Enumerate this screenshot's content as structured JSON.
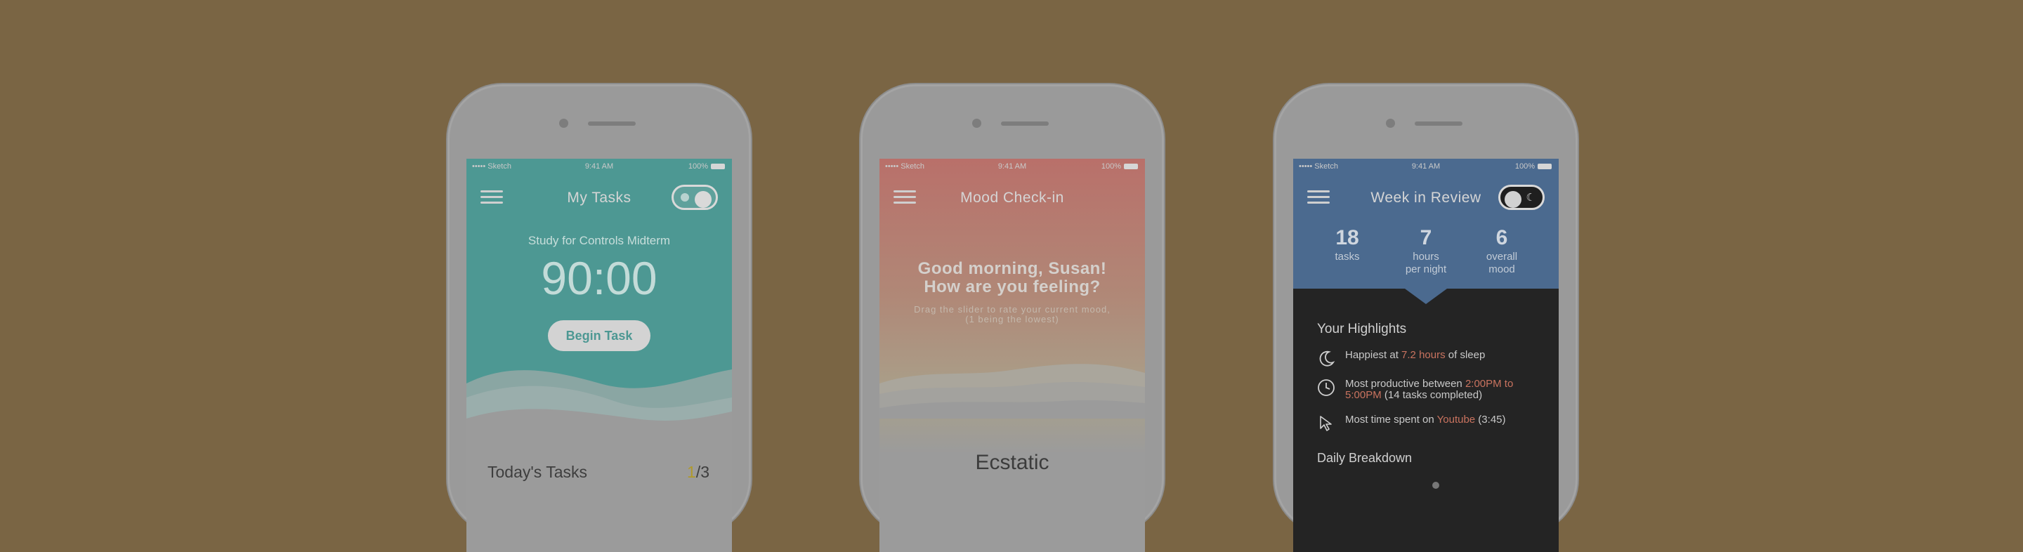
{
  "status": {
    "carrier": "••••• Sketch",
    "time": "9:41 AM",
    "battery": "100%"
  },
  "screen1": {
    "title": "My Tasks",
    "current_task": "Study for Controls Midterm",
    "timer": "90:00",
    "begin_label": "Begin Task",
    "section_label": "Today's Tasks",
    "count_done": "1",
    "count_total": "/3"
  },
  "screen2": {
    "title": "Mood Check-in",
    "greeting_line1": "Good morning, Susan!",
    "greeting_line2": "How are you feeling?",
    "hint_line1": "Drag the slider to rate your current mood,",
    "hint_line2": "(1 being the lowest)",
    "mood_label": "Ecstatic"
  },
  "screen3": {
    "title": "Week in Review",
    "stats": [
      {
        "value": "18",
        "label1": "tasks",
        "label2": ""
      },
      {
        "value": "7",
        "label1": "hours",
        "label2": "per night"
      },
      {
        "value": "6",
        "label1": "overall",
        "label2": "mood"
      }
    ],
    "highlights_title": "Your Highlights",
    "highlights": [
      {
        "pre": "Happiest at ",
        "hi": "7.2 hours",
        "post": " of sleep",
        "icon": "moon-icon"
      },
      {
        "pre": "Most productive between ",
        "hi": "2:00PM to 5:00PM",
        "post": " (14 tasks completed)",
        "icon": "clock-icon"
      },
      {
        "pre": "Most time spent on ",
        "hi": "Youtube",
        "post": " (3:45)",
        "icon": "cursor-icon"
      }
    ],
    "daily_title": "Daily Breakdown"
  },
  "colors": {
    "background": "#7a6544",
    "teal": "#4d9893",
    "blue": "#4b6a8f",
    "highlight": "#c9735f",
    "gold": "#b09a2a"
  }
}
